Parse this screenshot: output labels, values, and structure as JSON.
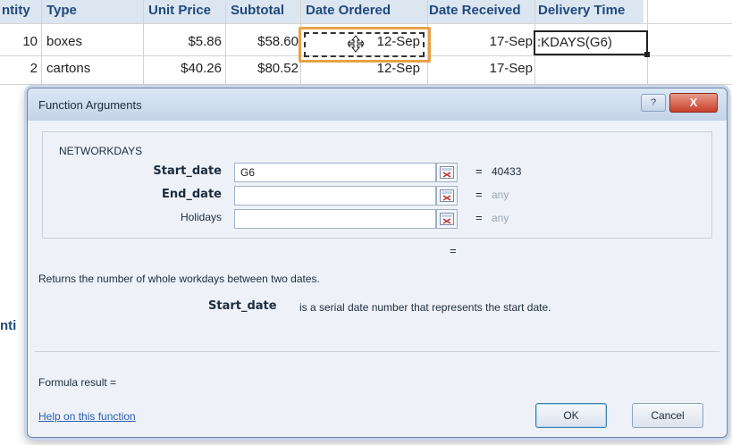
{
  "spreadsheet": {
    "headers": [
      "ntity",
      "Type",
      "Unit Price",
      "Subtotal",
      "Date Ordered",
      "Date Received",
      "Delivery Time"
    ],
    "rows": [
      {
        "qty": "10",
        "type": "boxes",
        "unit_price": "$5.86",
        "subtotal": "$58.60",
        "date_ordered": "12-Sep",
        "date_received": "17-Sep",
        "delivery": ":KDAYS(G6)"
      },
      {
        "qty": "2",
        "type": "cartons",
        "unit_price": "$40.26",
        "subtotal": "$80.52",
        "date_ordered": "12-Sep",
        "date_received": "17-Sep",
        "delivery": ""
      }
    ],
    "left_stub": "nti"
  },
  "dialog": {
    "title": "Function Arguments",
    "help_button": "?",
    "close_button": "X",
    "function_name": "NETWORKDAYS",
    "args": [
      {
        "label": "Start_date",
        "value": "G6",
        "eq": "=",
        "result": "40433",
        "muted": false
      },
      {
        "label": "End_date",
        "value": "",
        "eq": "=",
        "result": "any",
        "muted": true
      },
      {
        "label": "Holidays",
        "value": "",
        "eq": "=",
        "result": "any",
        "muted": true
      }
    ],
    "total_eq": "=",
    "description": "Returns the number of whole workdays between two dates.",
    "arg_desc_name": "Start_date",
    "arg_desc_text": "is a serial date number that represents the start date.",
    "formula_result": "Formula result =",
    "help_link": "Help on this function",
    "ok": "OK",
    "cancel": "Cancel"
  },
  "colors": {
    "header_text": "#1f497d",
    "highlight": "#e8a14b",
    "link": "#2a5db0"
  }
}
